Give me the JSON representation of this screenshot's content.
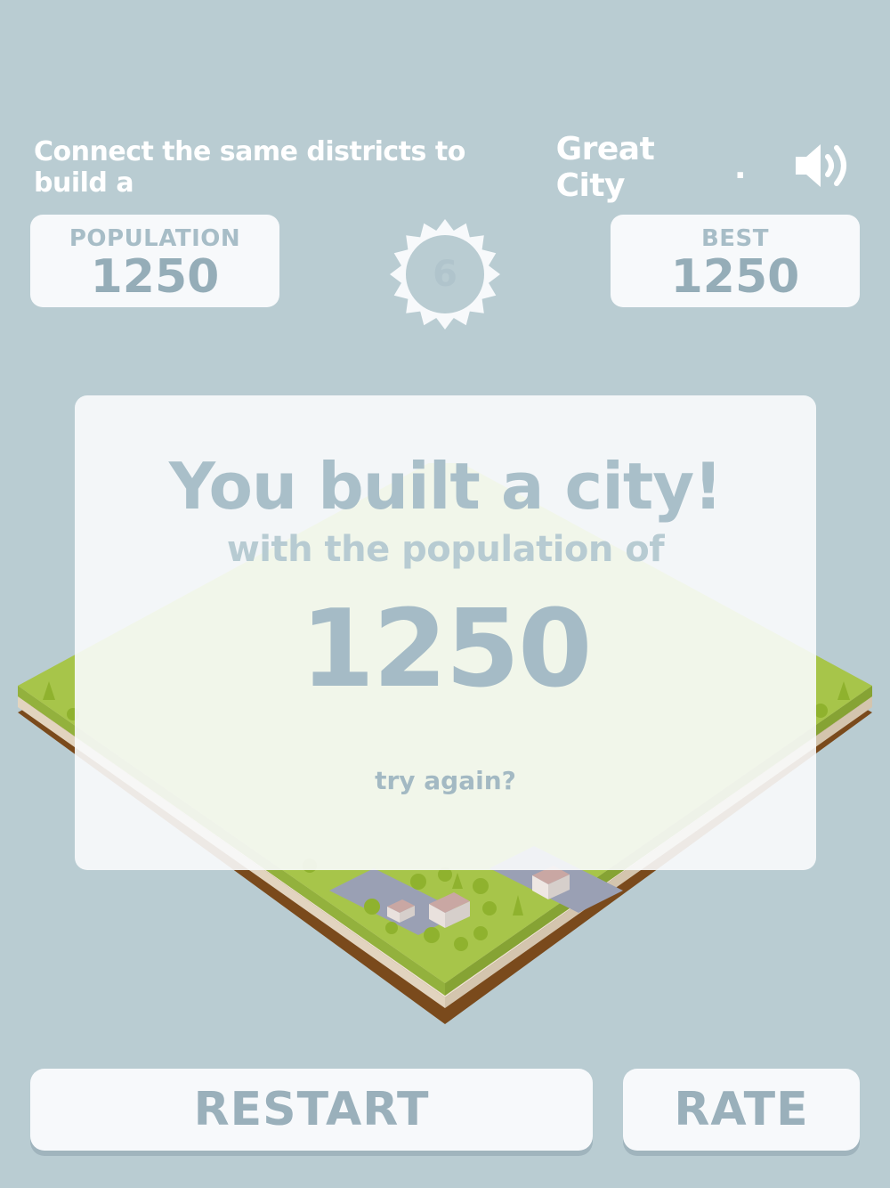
{
  "header": {
    "instruction_part1": "Connect the same districts to build a",
    "instruction_emphasis": "Great City",
    "instruction_end": "."
  },
  "sound_icon": "speaker-on-icon",
  "population": {
    "label": "POPULATION",
    "value": "1250"
  },
  "level": {
    "value": "6"
  },
  "best": {
    "label": "BEST",
    "value": "1250"
  },
  "result_panel": {
    "title": "You built a city!",
    "subtitle": "with the population of",
    "score": "1250",
    "try_again": "try again?"
  },
  "buttons": {
    "restart": "RESTART",
    "rate": "RATE"
  },
  "colors": {
    "background": "#b9ccd2",
    "panel": "#f7f9fb",
    "text_muted": "#95adb8",
    "grass": "#a7c54a",
    "soil": "#7a4a1c"
  }
}
